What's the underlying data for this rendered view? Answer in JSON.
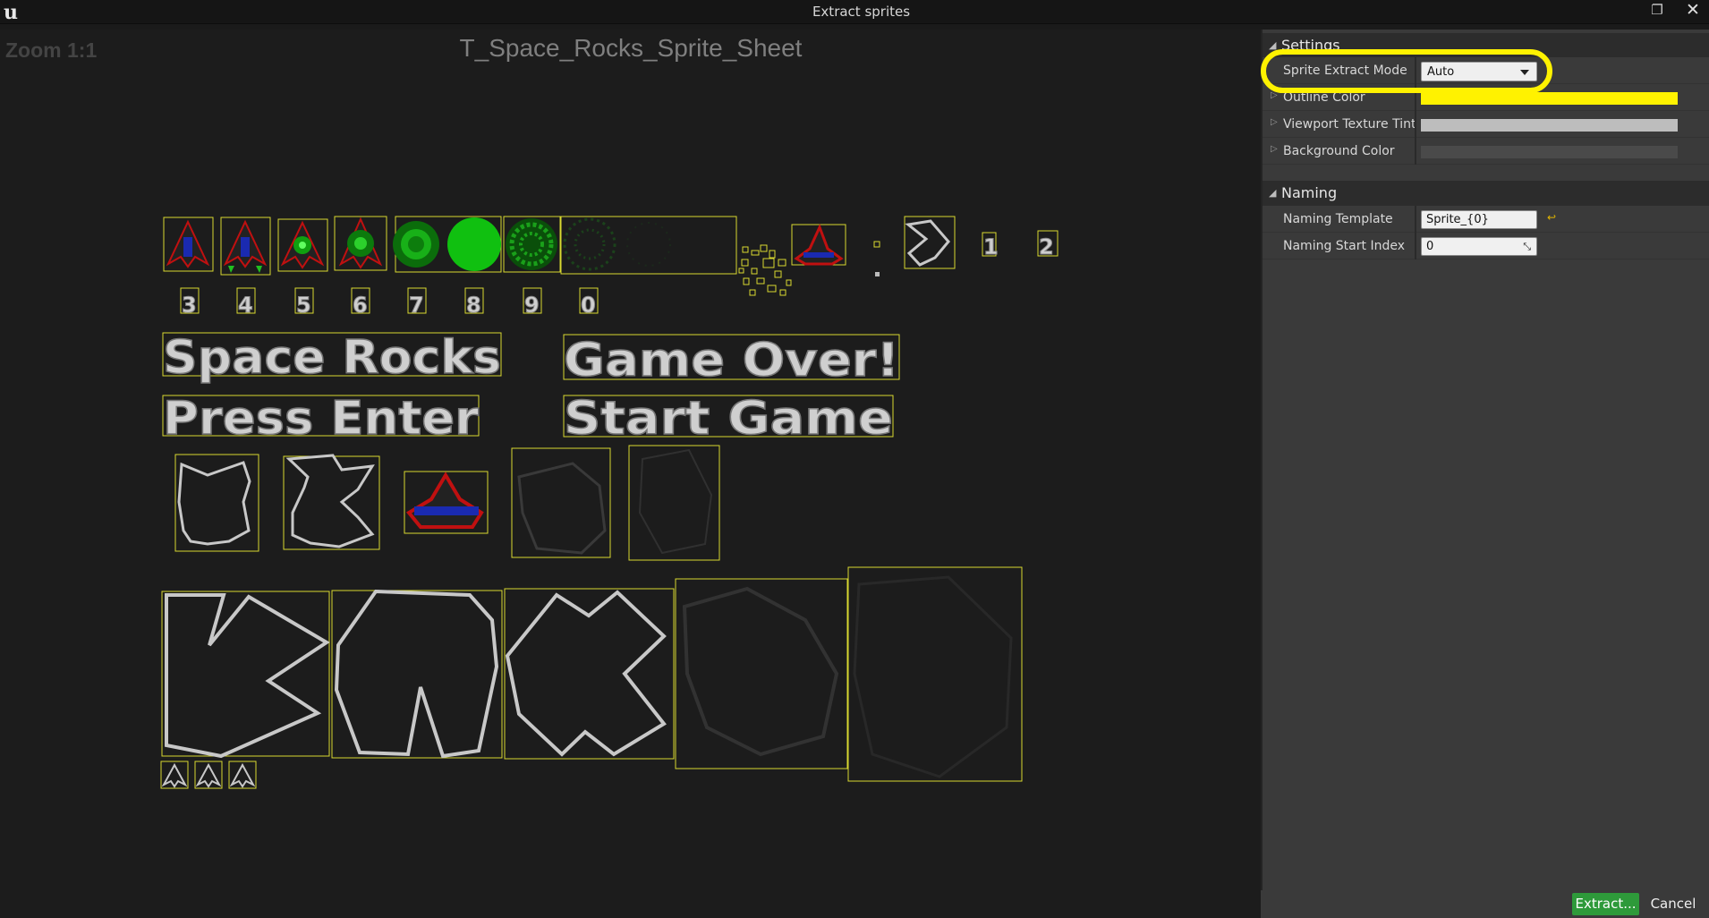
{
  "window": {
    "title": "Extract sprites",
    "restore_glyph": "❐",
    "close_glyph": "✕",
    "logo_glyph": "u"
  },
  "viewport": {
    "zoom_label": "Zoom 1:1",
    "texture_title": "T_Space_Rocks_Sprite_Sheet",
    "digits": [
      "1",
      "2",
      "3",
      "4",
      "5",
      "6",
      "7",
      "8",
      "9",
      "0"
    ],
    "texts": [
      "Space Rocks",
      "Game Over!",
      "Press Enter",
      "Start Game"
    ]
  },
  "settings": {
    "header": "Settings",
    "sprite_extract_mode_label": "Sprite Extract Mode",
    "sprite_extract_mode_value": "Auto",
    "outline_color_label": "Outline Color",
    "outline_color": "#fff200",
    "viewport_tint_label": "Viewport Texture Tint",
    "viewport_tint": "#bdbdbd",
    "background_color_label": "Background Color",
    "background_color": "#4a4a4a"
  },
  "naming": {
    "header": "Naming",
    "template_label": "Naming Template",
    "template_value": "Sprite_{0}",
    "start_index_label": "Naming Start Index",
    "start_index_value": "0"
  },
  "buttons": {
    "extract": "Extract...",
    "cancel": "Cancel"
  }
}
